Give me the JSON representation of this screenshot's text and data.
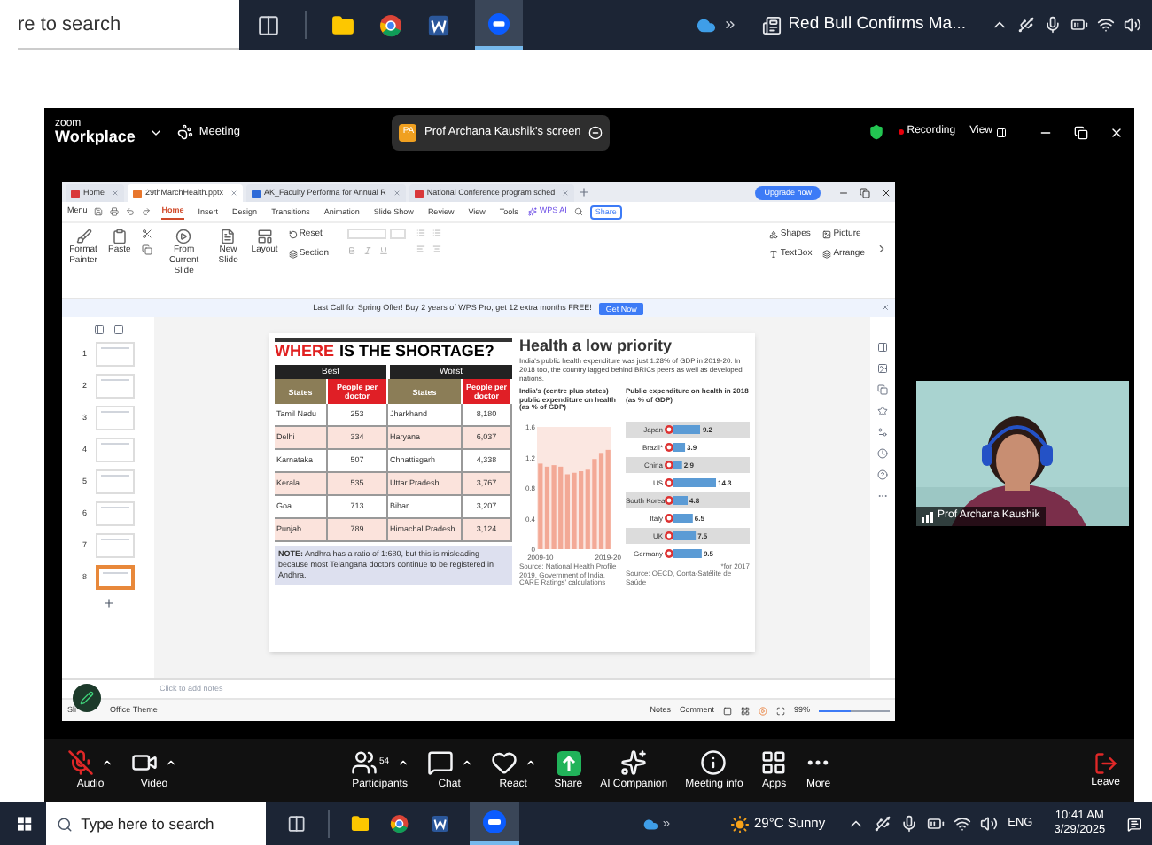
{
  "taskbar_top": {
    "search_placeholder": "re to search",
    "news": "Red Bull Confirms Ma..."
  },
  "zoom_header": {
    "brand_small": "zoom",
    "brand": "Workplace",
    "meeting_menu": "Meeting",
    "share_badge": "PA",
    "share_title": "Prof Archana Kaushik's screen",
    "recording": "Recording",
    "view": "View"
  },
  "wps": {
    "tabs": [
      {
        "label": "Home",
        "selected": false,
        "color": "#d9383a"
      },
      {
        "label": "29thMarchHealth.pptx",
        "selected": true,
        "color": "#e8762c"
      },
      {
        "label": "AK_Faculty Performa for Annual R",
        "selected": false,
        "color": "#2f6bd8"
      },
      {
        "label": "National Conference program sched",
        "selected": false,
        "color": "#d9383a"
      }
    ],
    "upgrade": "Upgrade now",
    "menu": "Menu",
    "ribbon_tabs": [
      {
        "label": "Home",
        "selected": true
      },
      {
        "label": "Insert",
        "selected": false
      },
      {
        "label": "Design",
        "selected": false
      },
      {
        "label": "Transitions",
        "selected": false
      },
      {
        "label": "Animation",
        "selected": false
      },
      {
        "label": "Slide Show",
        "selected": false
      },
      {
        "label": "Review",
        "selected": false
      },
      {
        "label": "View",
        "selected": false
      },
      {
        "label": "Tools",
        "selected": false
      }
    ],
    "wps_ai": "WPS AI",
    "share": "Share",
    "ribbon": {
      "format_painter": "Format Painter",
      "paste": "Paste",
      "from_current": "From Current Slide",
      "new_slide": "New Slide",
      "layout": "Layout",
      "reset": "Reset",
      "section": "Section",
      "shapes": "Shapes",
      "picture": "Picture",
      "textbox": "TextBox",
      "arrange": "Arrange"
    },
    "promo": "Last Call for Spring Offer! Buy 2 years of WPS Pro, get 12 extra months FREE!",
    "promo_button": "Get Now",
    "thumbnails": [
      {
        "number": "1",
        "selected": false
      },
      {
        "number": "2",
        "selected": false
      },
      {
        "number": "3",
        "selected": false
      },
      {
        "number": "4",
        "selected": false
      },
      {
        "number": "5",
        "selected": false
      },
      {
        "number": "6",
        "selected": false
      },
      {
        "number": "7",
        "selected": false
      },
      {
        "number": "8",
        "selected": true
      }
    ],
    "slide": {
      "title_red": "WHERE",
      "title_rest": "IS THE SHORTAGE?",
      "best": "Best",
      "worst": "Worst",
      "columns": [
        "States",
        "People per doctor",
        "States",
        "People per doctor"
      ],
      "rows": [
        [
          "Tamil Nadu",
          "253",
          "Jharkhand",
          "8,180"
        ],
        [
          "Delhi",
          "334",
          "Haryana",
          "6,037"
        ],
        [
          "Karnataka",
          "507",
          "Chhattisgarh",
          "4,338"
        ],
        [
          "Kerala",
          "535",
          "Uttar Pradesh",
          "3,767"
        ],
        [
          "Goa",
          "713",
          "Bihar",
          "3,207"
        ],
        [
          "Punjab",
          "789",
          "Himachal Pradesh",
          "3,124"
        ]
      ],
      "note": "**NOTE:** Andhra has a ratio of 1:680, but this is misleading because most Telangana doctors continue to be registered in Andhra.",
      "heading": "Health a low priority",
      "subtitle": "India's public health expenditure was just 1.28% of GDP in 2019-20. In 2018 too, the country lagged behind BRICs peers as well as developed nations.",
      "chart_left": {
        "chart_data": {
          "type": "bar",
          "title": "India's (centre plus states) public expenditure on health (as % of GDP)",
          "categories": [
            "2009-10",
            null,
            null,
            null,
            null,
            null,
            null,
            null,
            null,
            null,
            "2019-20"
          ],
          "values": [
            1.12,
            1.08,
            1.1,
            1.08,
            0.98,
            1.0,
            1.02,
            1.04,
            1.18,
            1.26,
            1.3
          ],
          "ylim": [
            0,
            1.6
          ],
          "yticks": [
            0,
            0.4,
            0.8,
            1.2,
            1.6
          ]
        },
        "source": "Source: National Health Profile 2019, Government of India, CARE Ratings' calculations"
      },
      "chart_right": {
        "chart_data": {
          "type": "bar",
          "orientation": "horizontal",
          "title": "Public expenditure on health in 2018 (as % of GDP)",
          "categories": [
            "Japan",
            "Brazil*",
            "China",
            "US",
            "South Korea",
            "Italy",
            "UK",
            "Germany"
          ],
          "values": [
            9.2,
            3.9,
            2.9,
            14.3,
            4.8,
            6.5,
            7.5,
            9.5
          ],
          "value_labels": [
            "9.2",
            "3.9",
            "2.9",
            "14.3",
            "4.8",
            "6.5",
            "7.5",
            "9.5"
          ]
        },
        "footnote": "*for 2017",
        "source": "Source: OECD, Conta-Satélite de Saúde"
      }
    },
    "notes_placeholder": "Click to add notes",
    "status": {
      "slide_label": "Sli",
      "theme": "Office Theme",
      "notes": "Notes",
      "comment": "Comment",
      "zoom": "99%",
      "zoom_slider": {
        "level": 0.45
      }
    }
  },
  "video": {
    "name": "Prof Archana Kaushik"
  },
  "toolbar": [
    {
      "label": "Audio",
      "has_menu": true,
      "muted": true
    },
    {
      "label": "Video",
      "has_menu": true
    },
    {
      "label": "Participants",
      "has_menu": true,
      "count": "54"
    },
    {
      "label": "Chat",
      "has_menu": true
    },
    {
      "label": "React",
      "has_menu": true
    },
    {
      "label": "Share",
      "has_menu": false
    },
    {
      "label": "AI Companion",
      "has_menu": false
    },
    {
      "label": "Meeting info",
      "has_menu": false
    },
    {
      "label": "Apps",
      "has_menu": false
    },
    {
      "label": "More",
      "has_menu": false
    }
  ],
  "leave": "Leave",
  "taskbar": {
    "search_placeholder": "Type here to search",
    "weather": "29°C Sunny",
    "language": "ENG",
    "time": "10:41 AM",
    "date": "3/29/2025"
  }
}
